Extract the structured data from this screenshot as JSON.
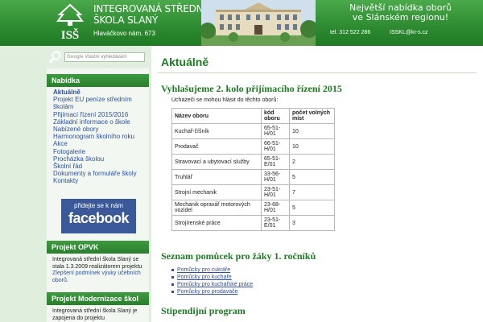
{
  "header": {
    "logo_text": "ISŠ",
    "school_name_line1": "INTEGROVANÁ STŘEDNÍ",
    "school_name_line2": "ŠKOLA SLANÝ",
    "address": "Hlaváčkovo nám. 673",
    "tagline_line1": "Největší nabídka oborů",
    "tagline_line2": "ve Slánském regionu!",
    "phone": "tel. 312 522 286",
    "email": "ISSKL@kr-s.cz"
  },
  "search": {
    "google_label": "Google",
    "placeholder": "Vlastní vyhledávání"
  },
  "sidebar": {
    "nabidka_title": "Nabídka",
    "items": [
      "Aktuálně",
      "Projekt EU peníze středním",
      "školám",
      "Přijímací řízení 2015/2016",
      "Základní informace o škole",
      "Nabízené obory",
      "Harmonogram školního roku",
      "Akce",
      "Fotogalerie",
      "Procházka školou",
      "Školní řád",
      "Dokumenty a formuláře školy",
      "Kontakty"
    ],
    "facebook_small": "přidejte se k nám",
    "facebook_big": "facebook",
    "opvk_title": "Projekt OPVK",
    "opvk_text1": "Integrovaná střední škola Slaný se stala 1.3.2009 realizátorem projektu",
    "opvk_link": "Zlepšení podmínek výuky učebních oborů.",
    "modern_title": "Projekt Modernizace škol",
    "modern_text": "Integrovaná střední škola Slaný je zapojena do projektu"
  },
  "main": {
    "page_title": "Aktuálně",
    "section1_title": "Vyhlašujeme 2. kolo přijímacího řízení 2015",
    "intro": "Uchazeči se mohou hlásit do těchto oborů:",
    "table_headers": [
      "Název oboru",
      "kód oboru",
      "počet volných míst"
    ],
    "table_rows": [
      [
        "Kuchař-číšník",
        "65-51-H/01",
        "10"
      ],
      [
        "Prodavač",
        "66-51-H/01",
        "10"
      ],
      [
        "Stravovací a ubytovací služby",
        "65-51-E/01",
        "2"
      ],
      [
        "Truhlář",
        "33-56-H/01",
        "5"
      ],
      [
        "Strojní mechanik",
        "23-51-H/01",
        "7"
      ],
      [
        "Mechanik opravář motorových vozidel",
        "23-68-H/01",
        "5"
      ],
      [
        "Strojírenské práce",
        "23-51-E/01",
        "3"
      ]
    ],
    "section2_title": "Seznam pomůcek pro žáky 1. ročníků",
    "links": [
      "Pomůcky pro cukráře",
      "Pomůcky pro kuchaře",
      "Pomůcky pro kuchařské práce",
      "Pomůcky pro prodavače"
    ],
    "section3_title": "Stipendijní program"
  }
}
